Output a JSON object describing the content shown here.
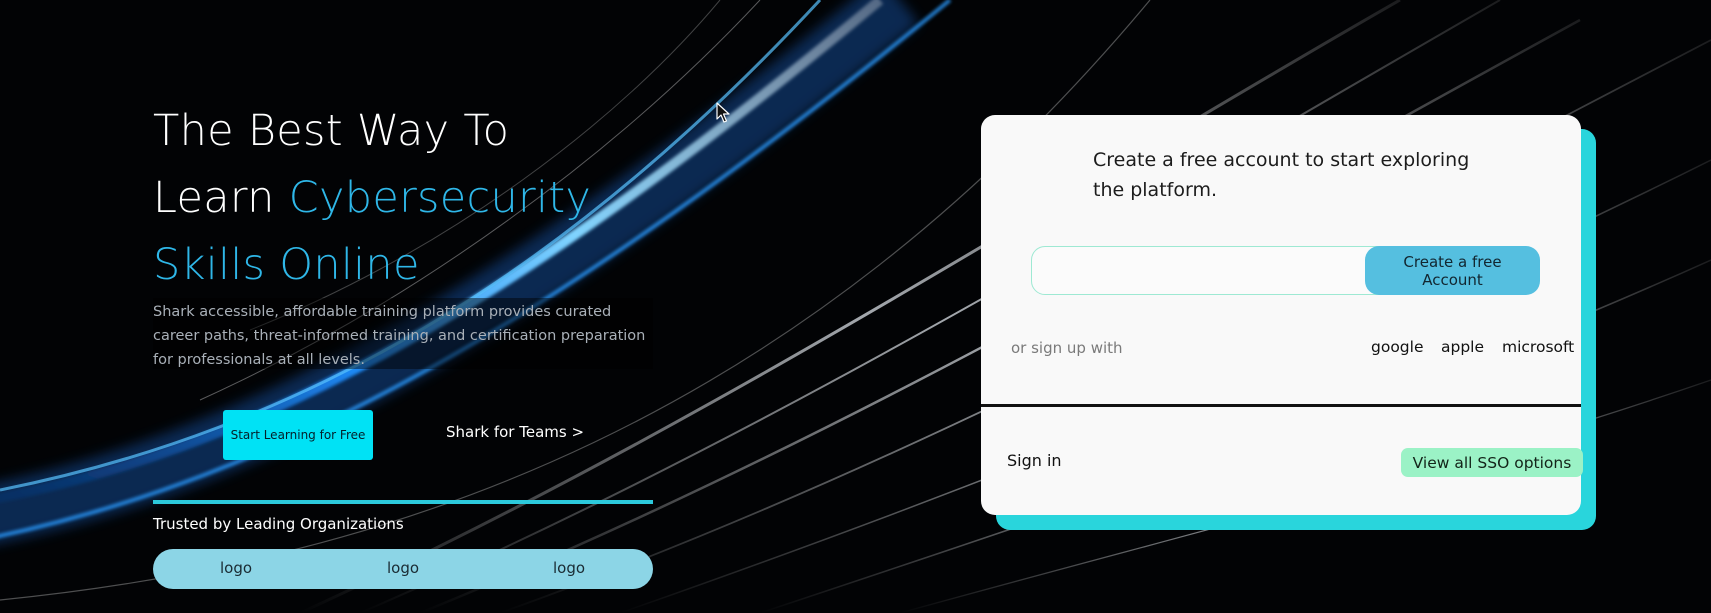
{
  "hero": {
    "headline_line1": "The Best Way To",
    "headline_learn": "Learn",
    "headline_accent1": "Cybersecurity",
    "headline_accent2": "Skills Online",
    "description": "Shark accessible, affordable training platform provides curated career paths, threat-informed training, and certification preparation for professionals at all levels.",
    "start_button": "Start Learning for Free",
    "teams_link": "Shark for Teams >",
    "trusted_label": "Trusted by Leading Organizations",
    "logos": [
      "logo",
      "logo",
      "logo"
    ],
    "accent_color": "#2fb7e8"
  },
  "signup_card": {
    "intro": "Create a free account to start exploring the platform.",
    "email_value": "",
    "create_button": "Create a free Account",
    "or_signup": "or sign up with",
    "providers": [
      "google",
      "apple",
      "microsoft"
    ],
    "signin_label": "Sign in",
    "sso_button": "View all SSO options",
    "shadow_color": "#29d5dc"
  },
  "icons": {
    "cursor": "mouse-pointer-icon"
  }
}
